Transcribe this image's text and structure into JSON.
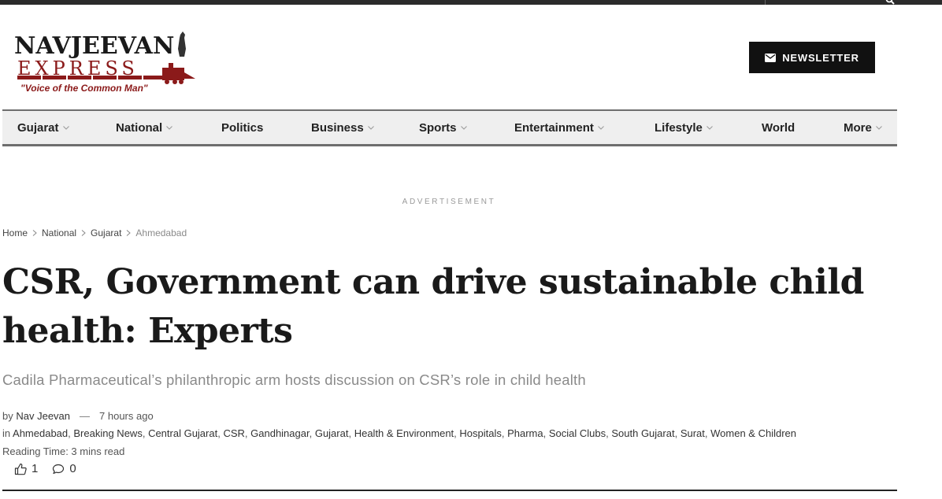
{
  "logo": {
    "line1": "NAVJEEVAN",
    "line2": "EXPRESS",
    "tagline": "\"Voice of the Common Man\""
  },
  "header": {
    "newsletter_label": "NEWSLETTER"
  },
  "nav": {
    "items": [
      {
        "label": "Gujarat",
        "dropdown": true
      },
      {
        "label": "National",
        "dropdown": true
      },
      {
        "label": "Politics",
        "dropdown": false
      },
      {
        "label": "Business",
        "dropdown": true
      },
      {
        "label": "Sports",
        "dropdown": true
      },
      {
        "label": "Entertainment",
        "dropdown": true
      },
      {
        "label": "Lifestyle",
        "dropdown": true
      },
      {
        "label": "World",
        "dropdown": false
      },
      {
        "label": "More",
        "dropdown": true
      }
    ]
  },
  "ad_label": "ADVERTISEMENT",
  "breadcrumb": [
    "Home",
    "National",
    "Gujarat",
    "Ahmedabad"
  ],
  "article": {
    "title": "CSR, Government can drive sustainable child health: Experts",
    "subtitle": "Cadila Pharmaceutical’s philanthropic arm hosts discussion on CSR’s role in child health",
    "by_prefix": "by",
    "author": "Nav Jeevan",
    "dash": "—",
    "time": "7 hours ago",
    "in_prefix": "in",
    "categories": [
      "Ahmedabad",
      "Breaking News",
      "Central Gujarat",
      "CSR",
      "Gandhinagar",
      "Gujarat",
      "Health & Environment",
      "Hospitals",
      "Pharma",
      "Social Clubs",
      "South Gujarat",
      "Surat",
      "Women & Children"
    ],
    "reading_time": "Reading Time: 3 mins read",
    "likes": "1",
    "comments": "0"
  },
  "colors": {
    "accent": "#111111",
    "logo_red": "#8b1a1a",
    "nav_bg": "#efefef"
  }
}
